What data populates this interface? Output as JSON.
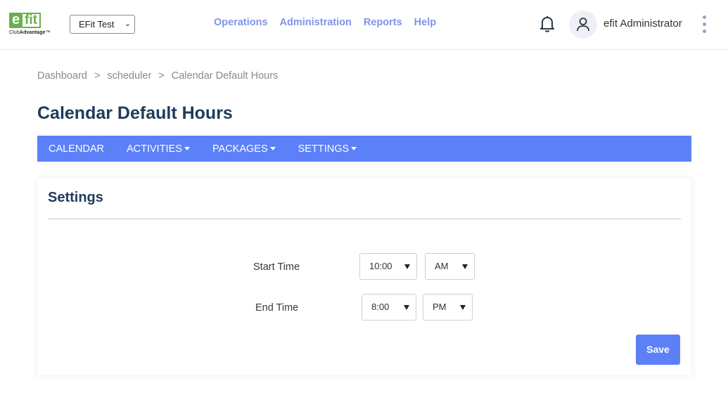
{
  "logo": {
    "mark_e": "e",
    "mark_fit": "fit",
    "sub_prefix": "Club",
    "sub_bold": "Advantage",
    "tm": "™"
  },
  "header": {
    "club_select": {
      "value": "EFit Test"
    },
    "nav": [
      {
        "label": "Operations"
      },
      {
        "label": "Administration"
      },
      {
        "label": "Reports"
      },
      {
        "label": "Help"
      }
    ],
    "user_name": "efit Administrator",
    "icons": {
      "notifications": "bell-icon",
      "avatar": "user-icon",
      "menu": "kebab-menu-icon"
    }
  },
  "breadcrumb": [
    {
      "label": "Dashboard"
    },
    {
      "label": "scheduler"
    },
    {
      "label": "Calendar Default Hours"
    }
  ],
  "breadcrumb_separator": ">",
  "page_title": "Calendar Default Hours",
  "subnav": [
    {
      "label": "CALENDAR",
      "dropdown": false
    },
    {
      "label": "ACTIVITIES",
      "dropdown": true
    },
    {
      "label": "PACKAGES",
      "dropdown": true
    },
    {
      "label": "SETTINGS",
      "dropdown": true
    }
  ],
  "settings_card": {
    "title": "Settings",
    "start_time": {
      "label": "Start Time",
      "hour": "10:00",
      "period": "AM"
    },
    "end_time": {
      "label": "End Time",
      "hour": "8:00",
      "period": "PM"
    },
    "save_label": "Save"
  },
  "colors": {
    "accent": "#5c80f7",
    "nav_link": "#7f96e6",
    "title": "#1e3b5c",
    "logo_green": "#6ab04c"
  }
}
